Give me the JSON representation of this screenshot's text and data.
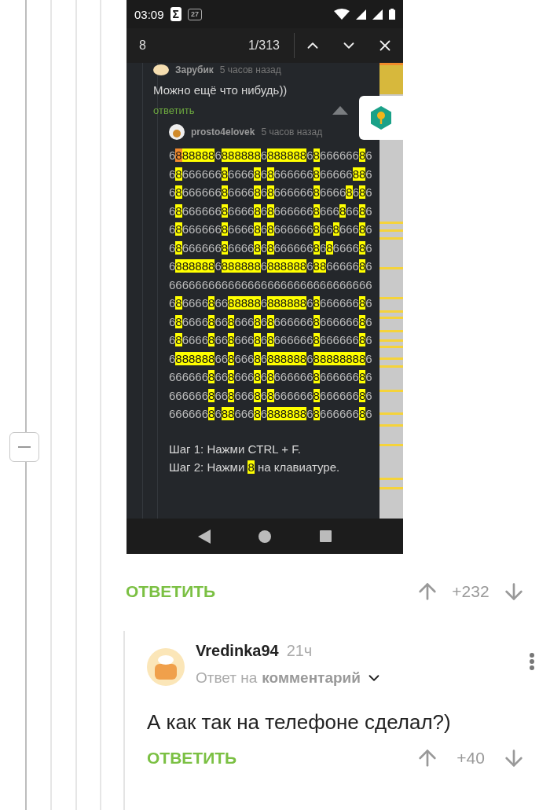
{
  "phone_screenshot": {
    "status_bar": {
      "time": "03:09",
      "notifications": [
        "Σ",
        "27"
      ]
    },
    "find_bar": {
      "query": "8",
      "count": "1/313"
    },
    "first_comment": {
      "author": "Зарубик",
      "time": "5 часов назад",
      "text": "Можно ещё что нибудь))",
      "reply": "ответить"
    },
    "second_comment": {
      "author": "prosto4elovek",
      "time": "5 часов назад",
      "current_match_in_first_row": true,
      "rows": [
        "6888888688888868888886866666686",
        "6866666686666868666666866666886",
        "6866666686666868666666866668686",
        "6866666686666868666666866686686",
        "6866666686666868666666866866686",
        "6866666686666868666666868666686",
        "6888888688888868888886886666686",
        "6666666666666666666666666666666",
        "6866668668888868888886866666686",
        "6866668668666868666666866666686",
        "6866668668666868666666866666686",
        "6888888668666868888886888888886",
        "6666668668666868666666866666686",
        "6666668668666868666666866666686",
        "6666668688666868888886866666686"
      ],
      "lines": [
        "Шаг 1: Нажми CTRL + F.",
        "Шаг 2: Нажми 8 на клавиатуре."
      ]
    }
  },
  "comment": {
    "reply": "ОТВЕТИТЬ",
    "rating": "+232"
  },
  "reply_comment": {
    "author": "Vredinka94",
    "time": "21ч",
    "reply_to_prefix": "Ответ на",
    "reply_to_target": "комментарий",
    "text": "А как так на телефоне сделал?)",
    "reply": "ОТВЕТИТЬ",
    "rating": "+40"
  }
}
